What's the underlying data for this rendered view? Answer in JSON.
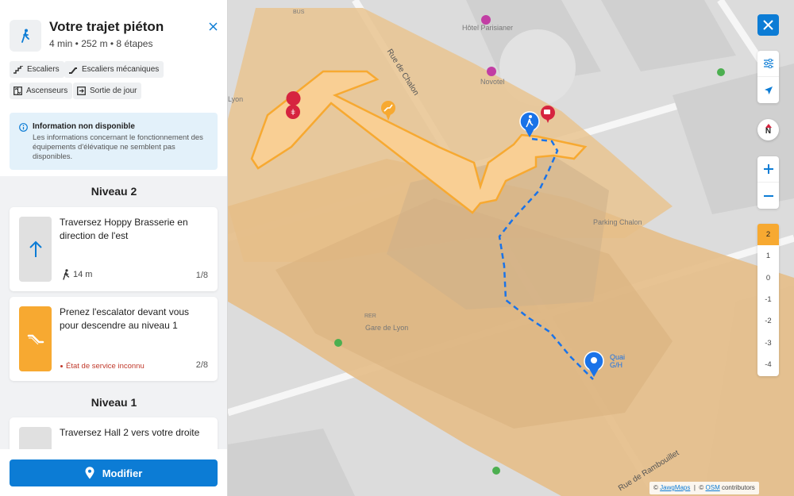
{
  "header": {
    "title": "Votre trajet piéton",
    "summary": "4 min • 252 m • 8 étapes"
  },
  "filters": [
    {
      "label": "Escaliers",
      "icon": "stairs-icon"
    },
    {
      "label": "Escaliers mécaniques",
      "icon": "escalator-icon"
    },
    {
      "label": "Ascenseurs",
      "icon": "elevator-icon"
    },
    {
      "label": "Sortie de jour",
      "icon": "exit-icon"
    }
  ],
  "info": {
    "title": "Information non disponible",
    "body": "Les informations concernant le fonctionnement des équipements d'élévatique ne semblent pas disponibles."
  },
  "levels": [
    {
      "heading": "Niveau 2"
    },
    {
      "heading": "Niveau 1"
    }
  ],
  "steps": [
    {
      "text": "Traversez Hoppy Brasserie en direction de l'est",
      "distance": "14 m",
      "counter": "1/8"
    },
    {
      "text": "Prenez l'escalator devant vous pour descendre au niveau 1",
      "status": "État de service inconnu",
      "counter": "2/8"
    },
    {
      "text": "Traversez Hall 2 vers votre droite"
    }
  ],
  "footer": {
    "modify_label": "Modifier"
  },
  "map": {
    "labels": {
      "hotel": "Hôtel Parisianer",
      "novotel": "Novotel",
      "rue_chalon": "Rue de Chalon",
      "parking": "Parking Chalon",
      "gare": "Gare de Lyon",
      "rambouillet": "Rue de Rambouillet",
      "lyon": "Lyon",
      "bus": "BUS",
      "rer": "RER",
      "destination": "Quai G/H"
    },
    "floors": [
      "2",
      "1",
      "0",
      "-1",
      "-2",
      "-3",
      "-4"
    ],
    "active_floor": "2",
    "compass_letter": "N",
    "attribution": {
      "prefix": "©",
      "jawg": "JawgMaps",
      "sep": "|",
      "prefix2": "©",
      "osm": "OSM",
      "suffix": "contributors"
    }
  },
  "colors": {
    "accent": "#0c7cd5",
    "active_floor": "#f7a931",
    "route": "#1a73e8",
    "status_warning": "#c0392b"
  }
}
